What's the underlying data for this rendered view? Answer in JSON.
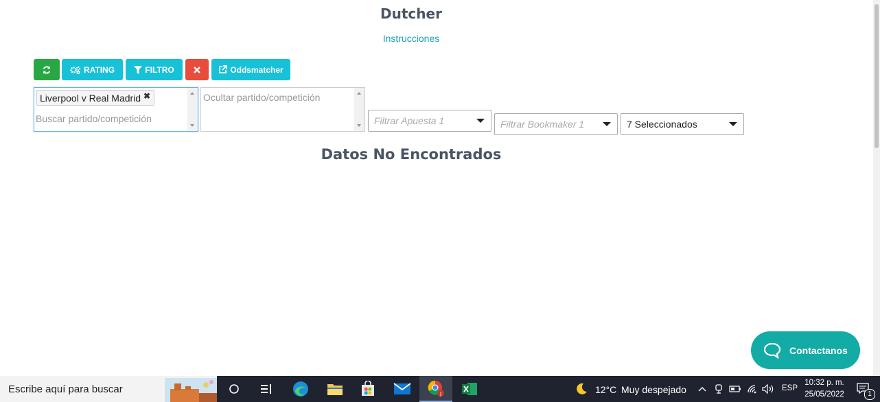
{
  "header": {
    "title": "Dutcher",
    "instructions_link": "Instrucciones"
  },
  "toolbar": {
    "rating_label": "RATING",
    "filter_label": "FILTRO",
    "oddsmatcher_label": "Oddsmatcher"
  },
  "filters": {
    "search_tags": [
      "Liverpool v Real Madrid"
    ],
    "search_placeholder": "Buscar partido/competición",
    "hide_placeholder": "Ocultar partido/competición",
    "bet_placeholder": "Filtrar Apuesta 1",
    "bookmaker_placeholder": "Filtrar Bookmaker 1",
    "selected_value": "7 Seleccionados"
  },
  "main": {
    "empty_message": "Datos No Encontrados"
  },
  "chat": {
    "contact_label": "Contactanos"
  },
  "taskbar": {
    "search_placeholder": "Escribe aquí para buscar",
    "weather_temp": "12°C",
    "weather_text": "Muy despejado",
    "language": "ESP",
    "time": "10:32 p. m.",
    "date": "25/05/2022",
    "notification_count": "1"
  },
  "colors": {
    "green": "#28a745",
    "cyan": "#17c1d8",
    "red": "#e74c3c",
    "teal": "#13aba6",
    "link": "#17a2b8"
  }
}
